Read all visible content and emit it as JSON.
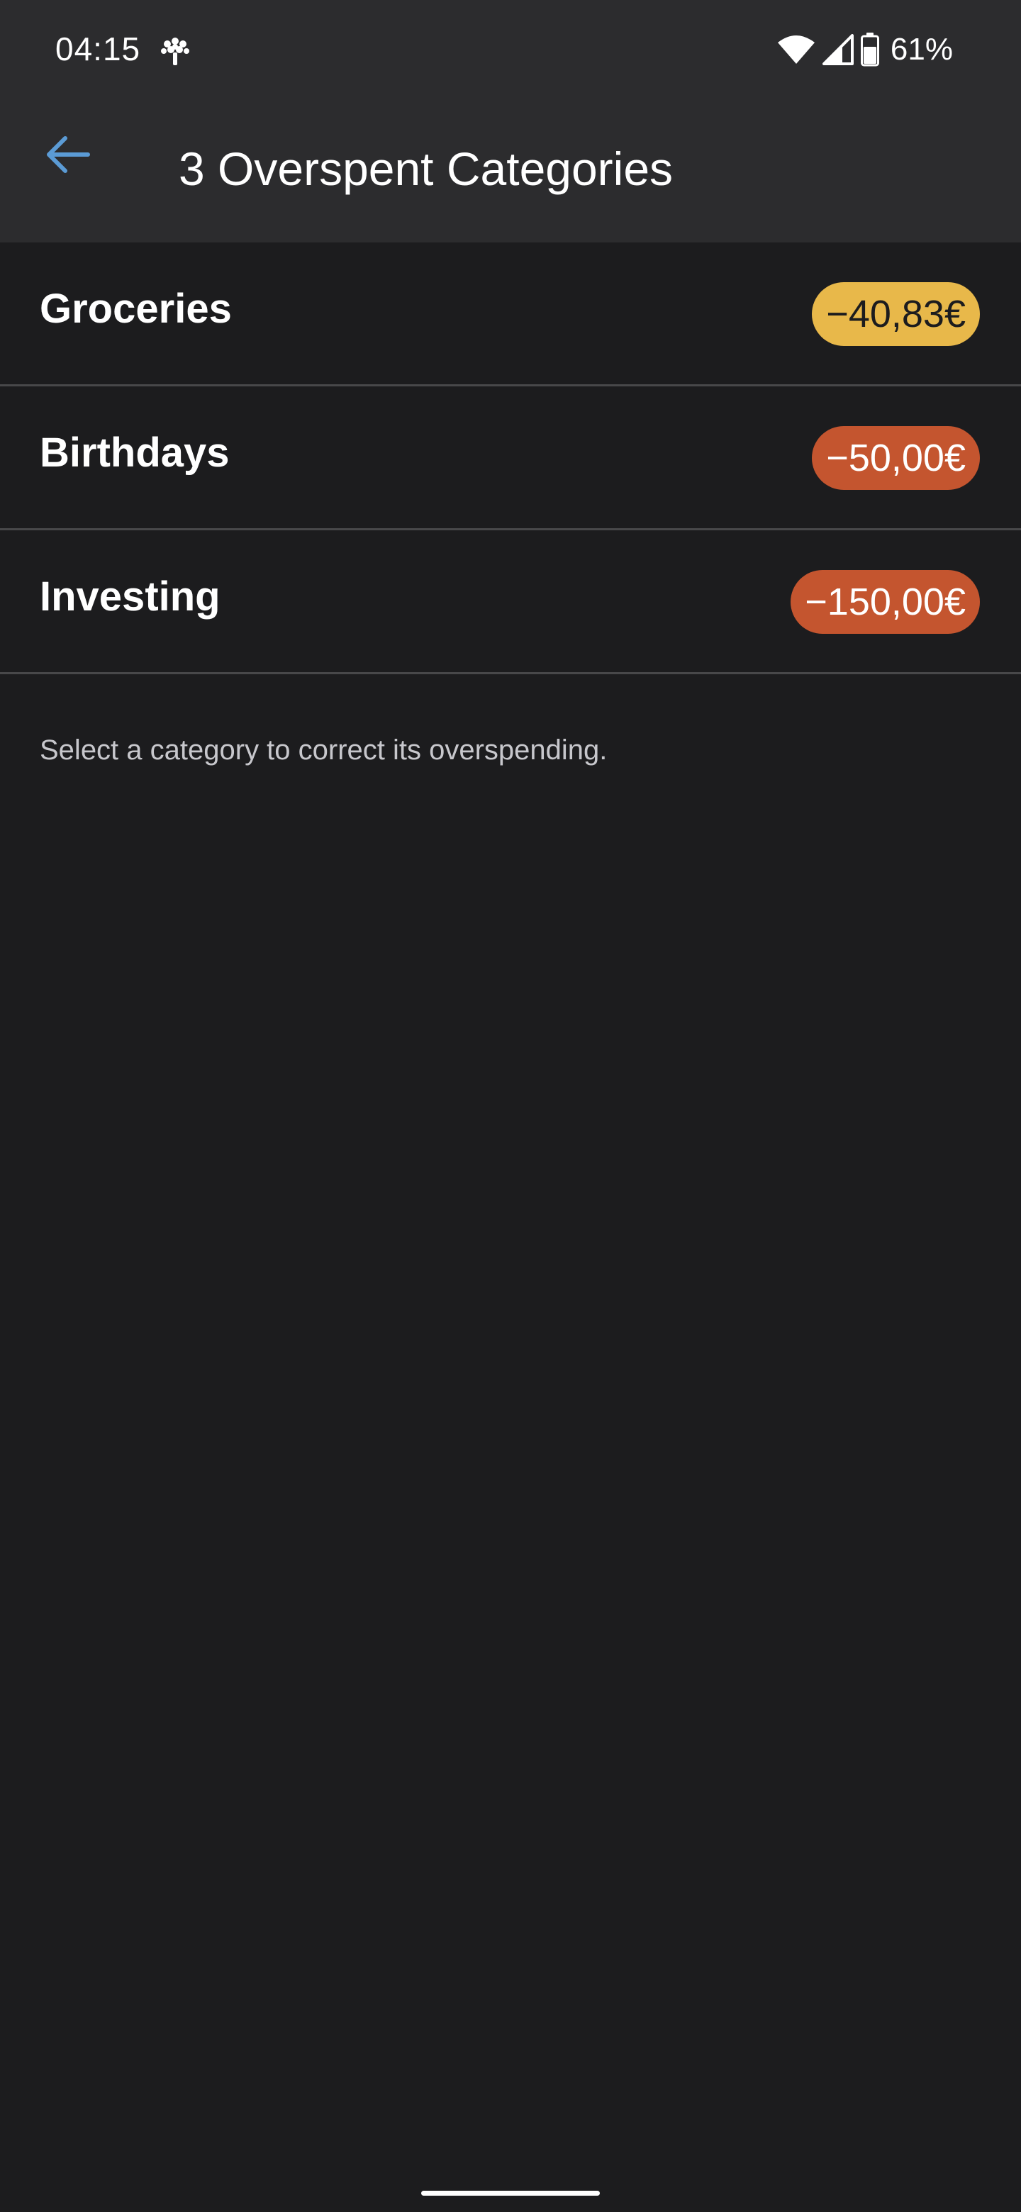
{
  "status_bar": {
    "time": "04:15",
    "app_icon": "tree-icon",
    "wifi_icon": "wifi-icon",
    "signal_icon": "cell-signal-icon",
    "battery_icon": "battery-icon",
    "battery_percent": "61%"
  },
  "app_bar": {
    "back_icon": "arrow-left-icon",
    "title": "3 Overspent Categories"
  },
  "categories": [
    {
      "name": "Groceries",
      "amount": "−40,83€",
      "pill_color": "#e8b84a",
      "text_color": "#1c1c1e"
    },
    {
      "name": "Birthdays",
      "amount": "−50,00€",
      "pill_color": "#c4552f",
      "text_color": "#ffffff"
    },
    {
      "name": "Investing",
      "amount": "−150,00€",
      "pill_color": "#c4552f",
      "text_color": "#ffffff"
    }
  ],
  "hint": "Select a category to correct its overspending.",
  "colors": {
    "background": "#1c1c1e",
    "bar_background": "#2c2c2e",
    "accent": "#5b9bd5",
    "divider": "#48484a"
  }
}
